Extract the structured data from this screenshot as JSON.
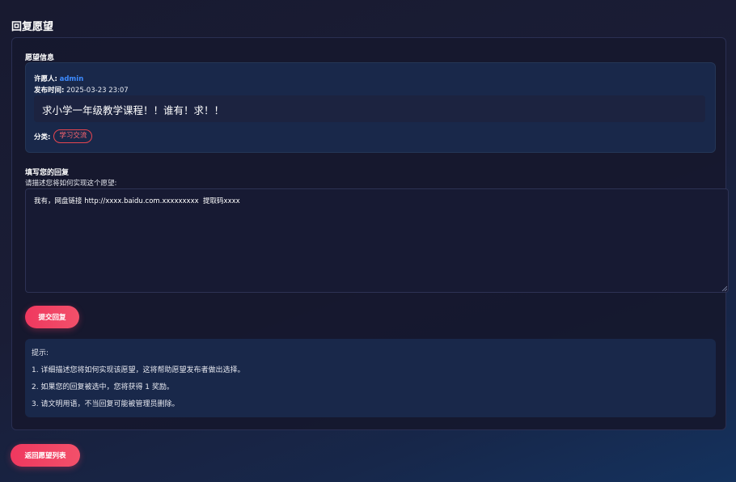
{
  "page": {
    "title": "回复愿望"
  },
  "wish_info": {
    "section_label": "愿望信息",
    "author_label": "许愿人:",
    "author_name": "admin",
    "publish_time_label": "发布时间:",
    "publish_time": "2025-03-23 23:07",
    "content": "求小学一年级教学课程！！谁有！求！！",
    "category_label": "分类:",
    "category_tag": "学习交流"
  },
  "reply_form": {
    "section_label": "填写您的回复",
    "hint": "请描述您将如何实现这个愿望:",
    "textarea_value": "我有，网盘链接 http://xxxx.baidu.com.xxxxxxxxx  提取码xxxx",
    "submit_label": "提交回复"
  },
  "tips": {
    "title": "提示:",
    "items": [
      "1. 详细描述您将如何实现该愿望，这将帮助愿望发布者做出选择。",
      "2. 如果您的回复被选中，您将获得 1 奖励。",
      "3. 请文明用语，不当回复可能被管理员删除。"
    ]
  },
  "footer": {
    "back_label": "返回愿望列表"
  },
  "colors": {
    "accent_link": "#3d8bff",
    "button_gradient_start": "#f0385f",
    "tag_border": "#e8454f",
    "background": "#1a1d36"
  }
}
